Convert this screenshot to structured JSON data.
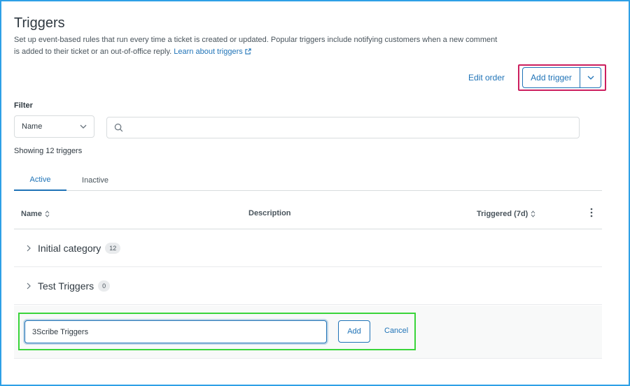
{
  "page": {
    "title": "Triggers",
    "description": "Set up event-based rules that run every time a ticket is created or updated. Popular triggers include notifying customers when a new comment is added to their ticket or an out-of-office reply.",
    "learn_link": "Learn about triggers"
  },
  "toolbar": {
    "edit_order_label": "Edit order",
    "add_trigger_label": "Add trigger"
  },
  "filter": {
    "label": "Filter",
    "selected": "Name",
    "search_value": ""
  },
  "summary": {
    "showing": "Showing 12 triggers"
  },
  "tabs": [
    {
      "label": "Active",
      "active": true
    },
    {
      "label": "Inactive",
      "active": false
    }
  ],
  "table": {
    "columns": {
      "name": "Name",
      "description": "Description",
      "triggered": "Triggered (7d)"
    },
    "categories": [
      {
        "name": "Initial category",
        "count": "12"
      },
      {
        "name": "Test Triggers",
        "count": "0"
      }
    ]
  },
  "new_category": {
    "value": "3Scribe Triggers",
    "add_label": "Add",
    "cancel_label": "Cancel"
  },
  "colors": {
    "accent": "#1f73b7",
    "highlight_red": "#cc1f5e",
    "highlight_green": "#3ad53a",
    "frame": "#2ea0e6"
  },
  "icons": [
    "external-link-icon",
    "chevron-down-icon",
    "search-icon",
    "sort-icon",
    "more-vertical-icon",
    "chevron-right-icon"
  ]
}
